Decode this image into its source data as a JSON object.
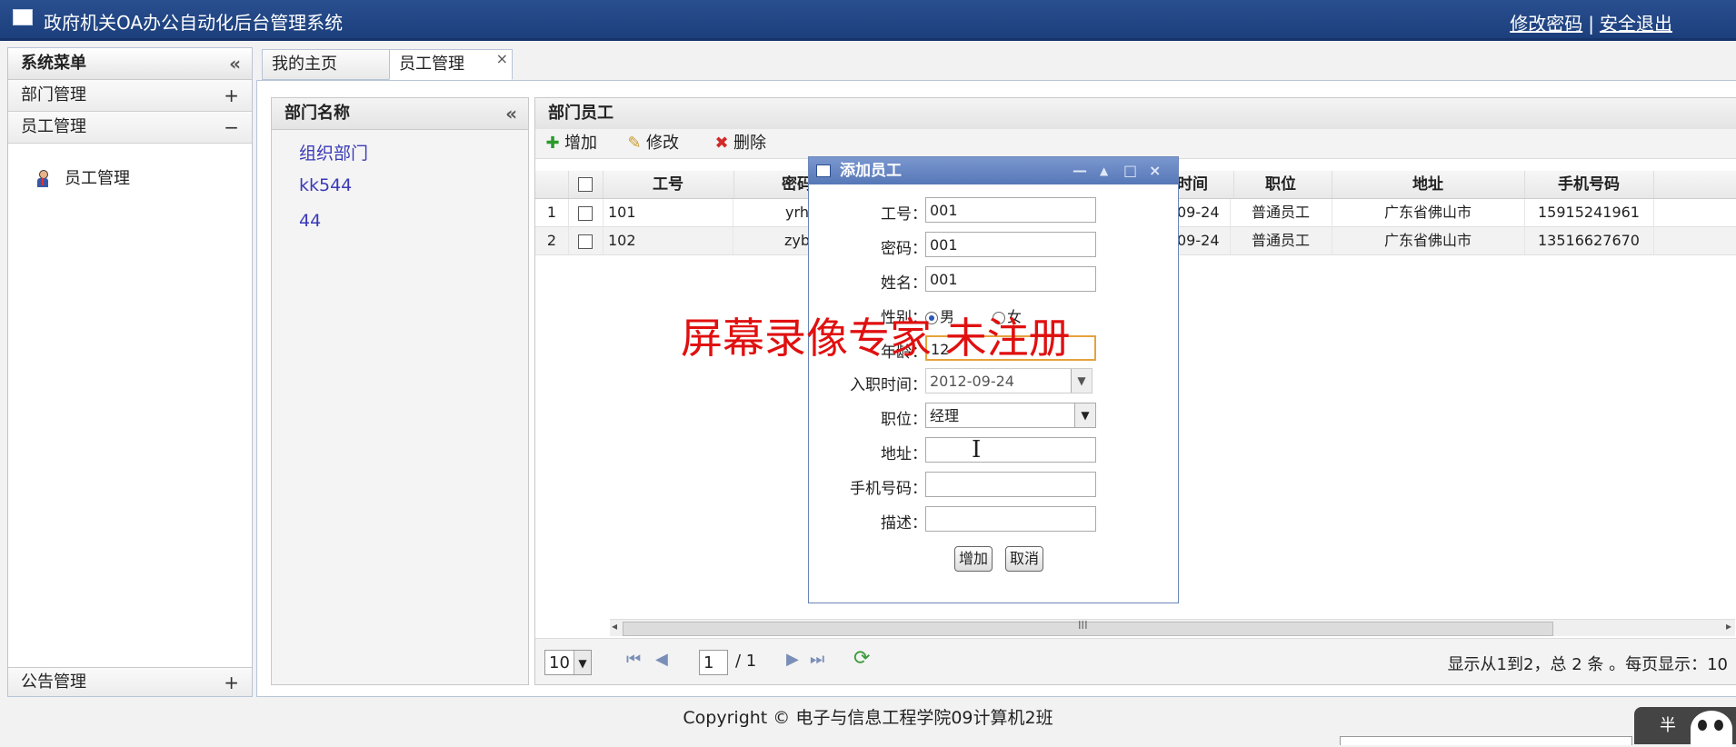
{
  "header": {
    "title": "政府机关OA办公自动化后台管理系统",
    "change_password": "修改密码",
    "separator": "|",
    "logout": "安全退出"
  },
  "sidebar": {
    "title": "系统菜单",
    "collapse": "«",
    "items": [
      {
        "label": "部门管理",
        "sign": "+"
      },
      {
        "label": "员工管理",
        "sign": "−"
      }
    ],
    "tree_item": "员工管理",
    "bottom_item": {
      "label": "公告管理",
      "sign": "+"
    }
  },
  "tabs": [
    {
      "label": "我的主页"
    },
    {
      "label": "员工管理",
      "close": "×"
    }
  ],
  "dept_panel": {
    "title": "部门名称",
    "collapse": "«",
    "departments": [
      "组织部门",
      "kk544",
      "44"
    ]
  },
  "emp_panel": {
    "title": "部门员工",
    "toolbar": {
      "add": "增加",
      "edit": "修改",
      "delete": "删除"
    },
    "columns": [
      "工号",
      "密码",
      "时间",
      "职位",
      "地址",
      "手机号码"
    ],
    "rows": [
      {
        "num": "1",
        "id": "101",
        "pwd": "yrh",
        "date": "09-24",
        "position": "普通员工",
        "address": "广东省佛山市",
        "phone": "15915241961"
      },
      {
        "num": "2",
        "id": "102",
        "pwd": "zyb",
        "date": "09-24",
        "position": "普通员工",
        "address": "广东省佛山市",
        "phone": "13516627670"
      }
    ],
    "scroll_grip": "III",
    "pager": {
      "page_size": "10",
      "page": "1",
      "total_pages": "/ 1",
      "info": "显示从1到2，总 2 条 。每页显示：10"
    }
  },
  "dialog": {
    "title": "添加员工",
    "controls": {
      "minimize": "—",
      "collapse": "▲",
      "maximize": "□",
      "close": "×"
    },
    "fields": {
      "id": {
        "label": "工号：",
        "value": "001"
      },
      "pwd": {
        "label": "密码：",
        "value": "001"
      },
      "name": {
        "label": "姓名：",
        "value": "001"
      },
      "gender": {
        "label": "性别：",
        "male": "男",
        "female": "女"
      },
      "age": {
        "label": "年龄：",
        "value": "12"
      },
      "hire_date": {
        "label": "入职时间：",
        "value": "2012-09-24"
      },
      "position": {
        "label": "职位：",
        "value": "经理"
      },
      "address": {
        "label": "地址：",
        "value": ""
      },
      "phone": {
        "label": "手机号码：",
        "value": ""
      },
      "desc": {
        "label": "描述：",
        "value": ""
      }
    },
    "buttons": {
      "add": "增加",
      "cancel": "取消"
    }
  },
  "watermark": "屏幕录像专家  未注册",
  "footer": "Copyright © 电子与信息工程学院09计算机2班",
  "corner_badge": "半"
}
